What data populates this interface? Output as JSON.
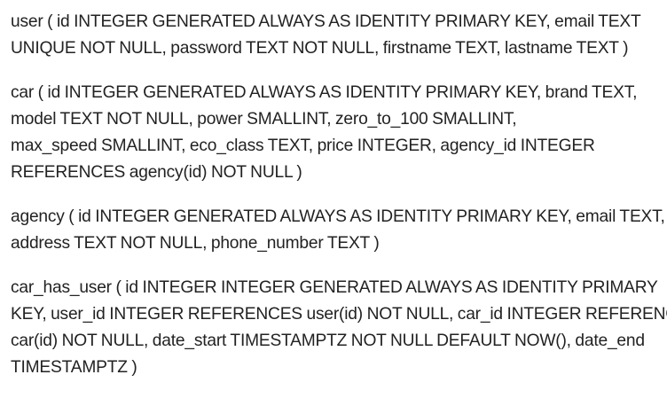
{
  "paragraphs": [
    {
      "id": "user",
      "lines": [
        "user ( id INTEGER GENERATED ALWAYS AS IDENTITY PRIMARY KEY, email TEXT",
        "UNIQUE NOT NULL, password TEXT NOT NULL, firstname TEXT, lastname TEXT )"
      ]
    },
    {
      "id": "car",
      "lines": [
        "car ( id INTEGER GENERATED ALWAYS AS IDENTITY PRIMARY KEY, brand TEXT,",
        "model TEXT NOT NULL, power SMALLINT, zero_to_100 SMALLINT,",
        "max_speed SMALLINT, eco_class TEXT, price INTEGER, agency_id INTEGER",
        "REFERENCES agency(id) NOT NULL )"
      ]
    },
    {
      "id": "agency",
      "lines": [
        "agency ( id INTEGER GENERATED ALWAYS AS IDENTITY PRIMARY KEY, email TEXT,",
        "address TEXT NOT NULL, phone_number TEXT )"
      ]
    },
    {
      "id": "car-has-user",
      "lines": [
        "car_has_user ( id INTEGER INTEGER GENERATED ALWAYS AS IDENTITY PRIMARY",
        "KEY, user_id INTEGER REFERENCES user(id) NOT NULL, car_id INTEGER REFERENCES",
        "car(id) NOT NULL, date_start TIMESTAMPTZ NOT NULL DEFAULT NOW(), date_end",
        "TIMESTAMPTZ )"
      ]
    }
  ]
}
